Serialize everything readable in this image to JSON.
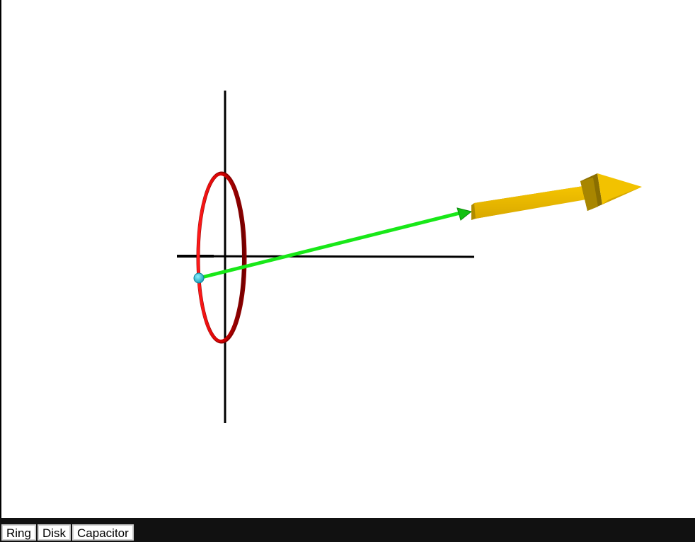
{
  "toolbar": {
    "buttons": [
      {
        "label": "Ring"
      },
      {
        "label": "Disk"
      },
      {
        "label": "Capacitor"
      }
    ]
  },
  "scene": {
    "colors": {
      "axes": "#000000",
      "ring": "#e00000",
      "ring_dark": "#7a0000",
      "source_point": "#22c8e0",
      "position_vector": "#18e818",
      "field_arrow": "#e8b800",
      "field_arrow_dark": "#8a6e00"
    }
  }
}
